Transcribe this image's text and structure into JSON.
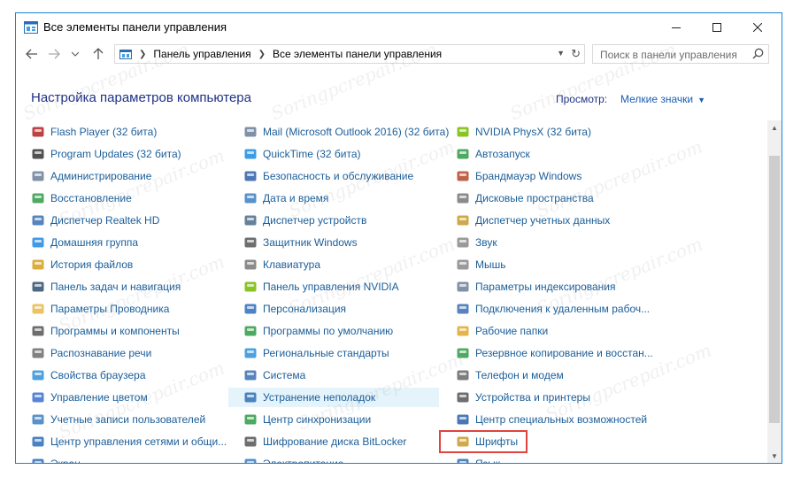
{
  "window": {
    "title": "Все элементы панели управления",
    "min_icon": "minimize-icon",
    "max_icon": "maximize-icon",
    "close_icon": "close-icon"
  },
  "address": {
    "crumbs": [
      "Панель управления",
      "Все элементы панели управления"
    ],
    "search_placeholder": "Поиск в панели управления"
  },
  "header": {
    "title": "Настройка параметров компьютера",
    "view_label": "Просмотр:",
    "view_value": "Мелкие значки"
  },
  "watermark": "Soringpcrepair.com",
  "columns": [
    [
      {
        "label": "Flash Player (32 бита)",
        "icon": "flash-player-icon",
        "color": "#b22222"
      },
      {
        "label": "Program Updates (32 бита)",
        "icon": "program-updates-icon",
        "color": "#333333"
      },
      {
        "label": "Администрирование",
        "icon": "administration-icon",
        "color": "#6a7f99"
      },
      {
        "label": "Восстановление",
        "icon": "recovery-icon",
        "color": "#2f9a46"
      },
      {
        "label": "Диспетчер Realtek HD",
        "icon": "realtek-icon",
        "color": "#3a6fb0"
      },
      {
        "label": "Домашняя группа",
        "icon": "homegroup-icon",
        "color": "#1e88e5"
      },
      {
        "label": "История файлов",
        "icon": "file-history-icon",
        "color": "#d4a017"
      },
      {
        "label": "Панель задач и навигация",
        "icon": "taskbar-icon",
        "color": "#2f4f6f"
      },
      {
        "label": "Параметры Проводника",
        "icon": "explorer-options-icon",
        "color": "#e8b84a"
      },
      {
        "label": "Программы и компоненты",
        "icon": "programs-icon",
        "color": "#555555"
      },
      {
        "label": "Распознавание речи",
        "icon": "speech-icon",
        "color": "#6b6b6b"
      },
      {
        "label": "Свойства браузера",
        "icon": "browser-properties-icon",
        "color": "#2f8fd8"
      },
      {
        "label": "Управление цветом",
        "icon": "color-management-icon",
        "color": "#3b6ed1"
      },
      {
        "label": "Учетные записи пользователей",
        "icon": "user-accounts-icon",
        "color": "#3d7ebf"
      },
      {
        "label": "Центр управления сетями и общи...",
        "icon": "network-center-icon",
        "color": "#2a6cb8"
      },
      {
        "label": "Экран",
        "icon": "display-icon",
        "color": "#2f6fb5"
      }
    ],
    [
      {
        "label": "Mail (Microsoft Outlook 2016) (32 бита)",
        "icon": "mail-icon",
        "color": "#6a7d9a"
      },
      {
        "label": "QuickTime (32 бита)",
        "icon": "quicktime-icon",
        "color": "#1a8be0"
      },
      {
        "label": "Безопасность и обслуживание",
        "icon": "security-flag-icon",
        "color": "#2b5fa8"
      },
      {
        "label": "Дата и время",
        "icon": "date-time-icon",
        "color": "#3a7fc2"
      },
      {
        "label": "Диспетчер устройств",
        "icon": "device-manager-icon",
        "color": "#4a6b8a"
      },
      {
        "label": "Защитник Windows",
        "icon": "windows-defender-icon",
        "color": "#555555"
      },
      {
        "label": "Клавиатура",
        "icon": "keyboard-icon",
        "color": "#777777"
      },
      {
        "label": "Панель управления NVIDIA",
        "icon": "nvidia-panel-icon",
        "color": "#76b900"
      },
      {
        "label": "Персонализация",
        "icon": "personalization-icon",
        "color": "#2e6dbb"
      },
      {
        "label": "Программы по умолчанию",
        "icon": "default-programs-icon",
        "color": "#2f9a46"
      },
      {
        "label": "Региональные стандарты",
        "icon": "region-icon",
        "color": "#2f8fd8"
      },
      {
        "label": "Система",
        "icon": "system-icon",
        "color": "#3a6fb0"
      },
      {
        "label": "Устранение неполадок",
        "icon": "troubleshooting-icon",
        "color": "#2f6fb5"
      },
      {
        "label": "Центр синхронизации",
        "icon": "sync-center-icon",
        "color": "#2f9a46"
      },
      {
        "label": "Шифрование диска BitLocker",
        "icon": "bitlocker-icon",
        "color": "#555555"
      },
      {
        "label": "Электропитание",
        "icon": "power-options-icon",
        "color": "#3a7fc2"
      }
    ],
    [
      {
        "label": "NVIDIA PhysX (32 бита)",
        "icon": "nvidia-physx-icon",
        "color": "#76b900"
      },
      {
        "label": "Автозапуск",
        "icon": "autoplay-icon",
        "color": "#2f9a46"
      },
      {
        "label": "Брандмауэр Windows",
        "icon": "firewall-icon",
        "color": "#b5472a"
      },
      {
        "label": "Дисковые пространства",
        "icon": "storage-spaces-icon",
        "color": "#777777"
      },
      {
        "label": "Диспетчер учетных данных",
        "icon": "credential-manager-icon",
        "color": "#c59a2a"
      },
      {
        "label": "Звук",
        "icon": "sound-icon",
        "color": "#888888"
      },
      {
        "label": "Мышь",
        "icon": "mouse-icon",
        "color": "#888888"
      },
      {
        "label": "Параметры индексирования",
        "icon": "indexing-icon",
        "color": "#6b7f99"
      },
      {
        "label": "Подключения к удаленным рабоч...",
        "icon": "remote-desktop-icon",
        "color": "#3a6fb0"
      },
      {
        "label": "Рабочие папки",
        "icon": "work-folders-icon",
        "color": "#e0a82e"
      },
      {
        "label": "Резервное копирование и восстан...",
        "icon": "backup-icon",
        "color": "#2f9a46"
      },
      {
        "label": "Телефон и модем",
        "icon": "phone-modem-icon",
        "color": "#666666"
      },
      {
        "label": "Устройства и принтеры",
        "icon": "devices-printers-icon",
        "color": "#555555"
      },
      {
        "label": "Центр специальных возможностей",
        "icon": "ease-of-access-icon",
        "color": "#2b5fa8"
      },
      {
        "label": "Шрифты",
        "icon": "fonts-icon",
        "color": "#c79a2b"
      },
      {
        "label": "Язык",
        "icon": "language-icon",
        "color": "#2f6fb5"
      }
    ]
  ]
}
